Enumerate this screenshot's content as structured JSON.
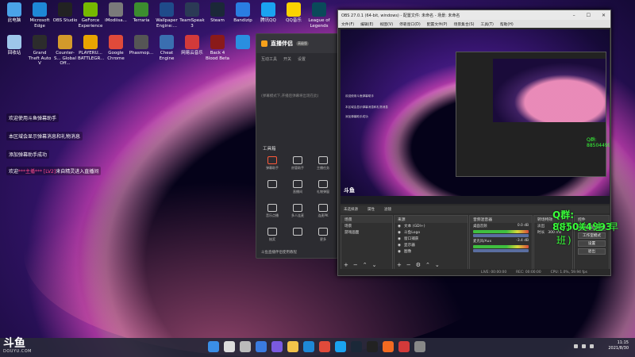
{
  "desktop_icons": [
    {
      "label": "此电脑",
      "icon": "computer-icon",
      "color": "#4aa3e8"
    },
    {
      "label": "Microsoft Edge",
      "icon": "edge-icon",
      "color": "#1e88d6"
    },
    {
      "label": "OBS Studio",
      "icon": "obs-icon",
      "color": "#222222"
    },
    {
      "label": "GeForce Experience",
      "icon": "geforce-icon",
      "color": "#76b900"
    },
    {
      "label": "iModiisa...",
      "icon": "gear-icon",
      "color": "#7a7a7a"
    },
    {
      "label": "Terraria",
      "icon": "terraria-icon",
      "color": "#3c8d2f"
    },
    {
      "label": "Wallpaper Engine:...",
      "icon": "wallpaper-icon",
      "color": "#1f4b8a"
    },
    {
      "label": "TeamSpeak 3",
      "icon": "teamspeak-icon",
      "color": "#2b3a55"
    },
    {
      "label": "Steam",
      "icon": "steam-icon",
      "color": "#1b2838"
    },
    {
      "label": "Bandizip",
      "icon": "bandizip-icon",
      "color": "#2a7de1"
    },
    {
      "label": "腾讯QQ",
      "icon": "qq-icon",
      "color": "#1aa3f0"
    },
    {
      "label": "QQ音乐",
      "icon": "qqmusic-icon",
      "color": "#fbd300"
    },
    {
      "label": "League of Legends",
      "icon": "lol-icon",
      "color": "#0a4a5a"
    },
    {
      "label": "回收站",
      "icon": "recycle-bin-icon",
      "color": "#9ec7ea"
    },
    {
      "label": "Grand Theft Auto V",
      "icon": "gta-icon",
      "color": "#2c2c2c"
    },
    {
      "label": "Counter-S... Global Off...",
      "icon": "csgo-icon",
      "color": "#d39a2b"
    },
    {
      "label": "PLAYERU... BATTLEGR...",
      "icon": "pubg-icon",
      "color": "#e8a400"
    },
    {
      "label": "Google Chrome",
      "icon": "chrome-icon",
      "color": "#e04a3a"
    },
    {
      "label": "Phasmop...",
      "icon": "phasmophobia-icon",
      "color": "#555555"
    },
    {
      "label": "Cheat Engine",
      "icon": "cheat-engine-icon",
      "color": "#3a6fb0"
    },
    {
      "label": "网易云音乐",
      "icon": "netease-music-icon",
      "color": "#d33a3a"
    },
    {
      "label": "Back 4 Blood Beta",
      "icon": "back4blood-icon",
      "color": "#8a1a1a"
    },
    {
      "label": "",
      "icon": "plane-icon",
      "color": "#2a8fe0"
    }
  ],
  "chat_lines": [
    {
      "text": "欢迎使用斗鱼弹幕助手"
    },
    {
      "text": "本区域会显示弹幕消息和礼物消息"
    },
    {
      "text": "添加弹幕助手成功"
    },
    {
      "prefix": "欢迎",
      "highlight": "***主播*** [LV2]",
      "suffix": "来自精灵进入直播间"
    }
  ],
  "helper": {
    "brand": "直播伴侣",
    "version": "高级版",
    "tabs": [
      "互动工具",
      "开关",
      "设置"
    ],
    "notice": "(弹幕模式下,开播后弹幕将出现在此)",
    "tools_title": "工具箱",
    "tools": [
      "弹幕助手",
      "房管助手",
      "主播任务",
      "",
      "直播间",
      "礼物弹窗",
      "音乐点播",
      "多人连麦",
      "连麦PK",
      "抽奖",
      "",
      "更多"
    ],
    "footer": "斗鱼直播伴侣使用教程"
  },
  "obs": {
    "title": "OBS 27.0.1 (64-bit, windows) - 配置文件: 未命名 - 场景: 未命名",
    "menu": [
      "文件(F)",
      "编辑(E)",
      "视图(V)",
      "停靠窗口(D)",
      "配置文件(P)",
      "场景集合(S)",
      "工具(T)",
      "帮助(H)"
    ],
    "preview_qq": "Q群: 885044993",
    "status_label": "未选择源",
    "status_items": [
      "属性",
      "滤镜"
    ],
    "scenes_title": "场景",
    "scenes": [
      "场景",
      "游戏画面"
    ],
    "sources_title": "来源",
    "sources": [
      "文本 (GDI+)",
      "斗鱼Logo",
      "窗口捕获",
      "显示器",
      "图像"
    ],
    "mixer_title": "音频混音器",
    "mixer": [
      {
        "name": "桌面音频",
        "db": "0.0 dB"
      },
      {
        "name": "麦克风/Aux",
        "db": "-3.4 dB"
      }
    ],
    "transition_title": "转场特效",
    "transition": {
      "type": "淡出",
      "duration_label": "时长",
      "duration": "300 ms"
    },
    "controls_title": "控件",
    "controls": [
      "开始虚拟摄像机",
      "工作室模式",
      "设置",
      "退出"
    ],
    "bottom": [
      "LIVE: 00:00:00",
      "REC: 00:00:00",
      "CPU: 1.0%, 59.94 fps"
    ]
  },
  "overlay": {
    "qq_group": "Q群: 885044993",
    "subtitle": "(打 关 注 早 班)"
  },
  "watermark": {
    "logo": "斗鱼",
    "url": "DOUYU.COM"
  },
  "taskbar": {
    "icons": [
      "start-icon",
      "search-icon",
      "task-view-icon",
      "widgets-icon",
      "chat-icon",
      "explorer-icon",
      "edge-icon",
      "chrome-icon",
      "qq-icon",
      "steam-icon",
      "obs-icon",
      "douyu-icon",
      "music-icon",
      "settings-icon"
    ],
    "icon_colors": [
      "#3a8ee6",
      "#dddddd",
      "#bbbbbb",
      "#3a7be0",
      "#7a5ae0",
      "#f2c34a",
      "#1e88d6",
      "#e04a3a",
      "#1aa3f0",
      "#1b2838",
      "#222222",
      "#f26a21",
      "#d33a3a",
      "#888888"
    ],
    "time": "11:15",
    "date": "2021/8/30"
  },
  "colors": {
    "accent_green": "#39ff3a",
    "highlight_pink": "#ff4c8b",
    "helper_brand": "#f7a11b"
  }
}
